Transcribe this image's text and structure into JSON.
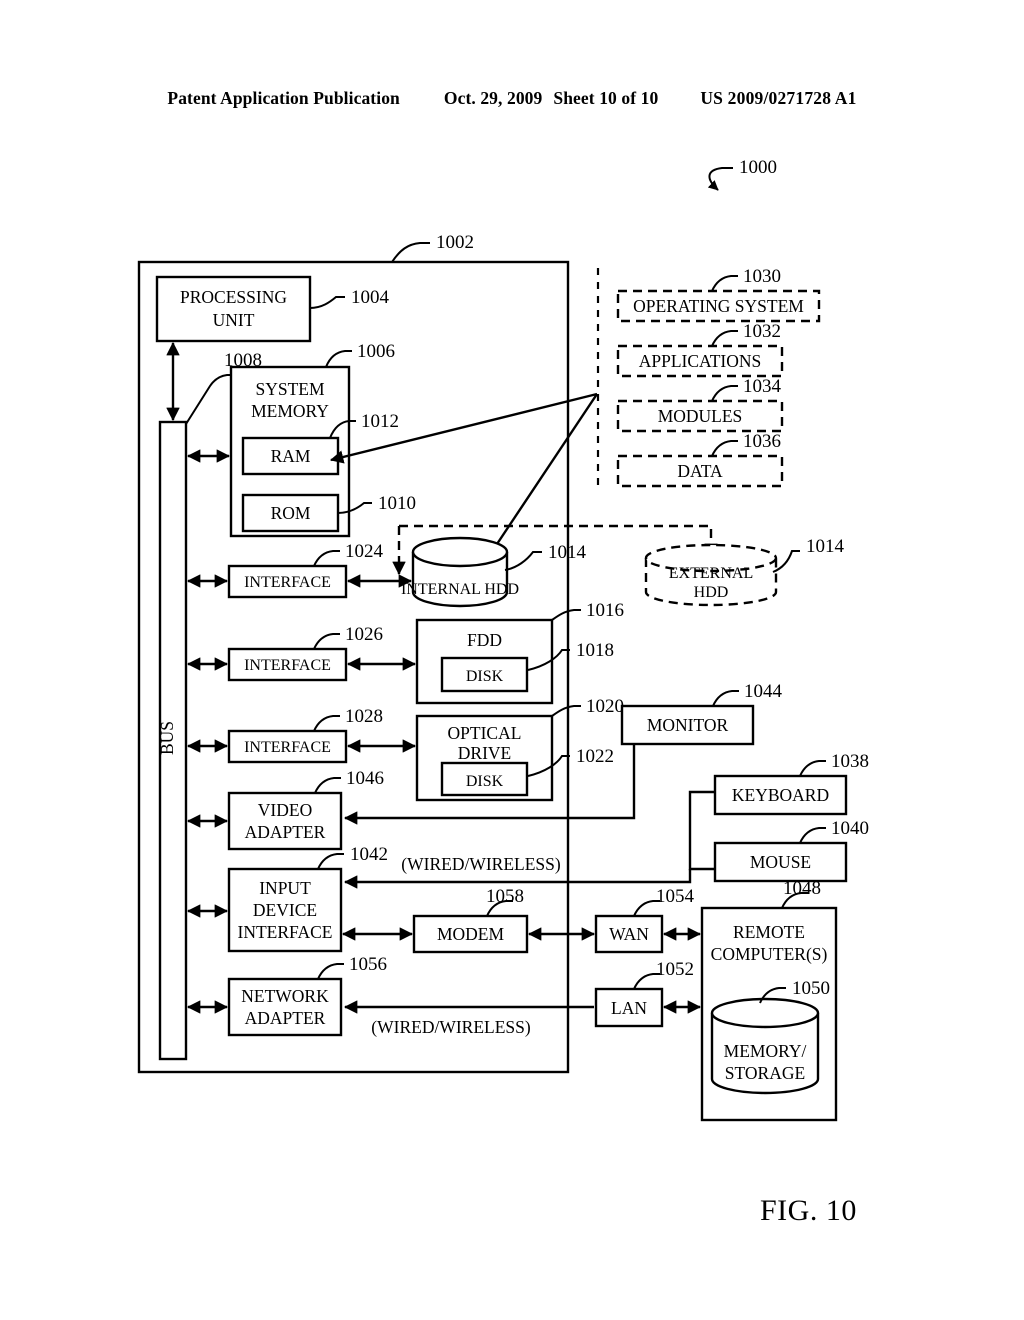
{
  "header": {
    "publication": "Patent Application Publication",
    "date": "Oct. 29, 2009",
    "sheet": "Sheet 10 of 10",
    "patent_number": "US 2009/0271728 A1"
  },
  "figure": {
    "caption": "FIG. 10",
    "system_ref": "1000"
  },
  "blocks": {
    "computer": {
      "label": "",
      "ref": "1002"
    },
    "processing_unit": {
      "label_line1": "PROCESSING",
      "label_line2": "UNIT",
      "ref": "1004"
    },
    "system_memory": {
      "label_line1": "SYSTEM",
      "label_line2": "MEMORY",
      "ref": "1006"
    },
    "bus": {
      "label": "BUS",
      "ref": "1008"
    },
    "rom": {
      "label": "ROM",
      "ref": "1010"
    },
    "ram": {
      "label": "RAM",
      "ref": "1012"
    },
    "internal_hdd": {
      "label": "INTERNAL HDD",
      "ref": "1014"
    },
    "external_hdd": {
      "label_line1": "EXTERNAL",
      "label_line2": "HDD",
      "ref": "1014"
    },
    "fdd": {
      "label": "FDD",
      "ref": "1016"
    },
    "fdd_disk": {
      "label": "DISK",
      "ref": "1018"
    },
    "optical_drive": {
      "label_line1": "OPTICAL",
      "label_line2": "DRIVE",
      "ref": "1020"
    },
    "optical_disk": {
      "label": "DISK",
      "ref": "1022"
    },
    "interface_hdd": {
      "label": "INTERFACE",
      "ref": "1024"
    },
    "interface_fdd": {
      "label": "INTERFACE",
      "ref": "1026"
    },
    "interface_optical": {
      "label": "INTERFACE",
      "ref": "1028"
    },
    "operating_system": {
      "label": "OPERATING SYSTEM",
      "ref": "1030"
    },
    "applications": {
      "label": "APPLICATIONS",
      "ref": "1032"
    },
    "modules": {
      "label": "MODULES",
      "ref": "1034"
    },
    "data": {
      "label": "DATA",
      "ref": "1036"
    },
    "keyboard": {
      "label": "KEYBOARD",
      "ref": "1038"
    },
    "mouse": {
      "label": "MOUSE",
      "ref": "1040"
    },
    "input_device_interface": {
      "label_line1": "INPUT",
      "label_line2": "DEVICE",
      "label_line3": "INTERFACE",
      "ref": "1042"
    },
    "monitor": {
      "label": "MONITOR",
      "ref": "1044"
    },
    "video_adapter": {
      "label_line1": "VIDEO",
      "label_line2": "ADAPTER",
      "ref": "1046"
    },
    "remote_computers": {
      "label_line1": "REMOTE",
      "label_line2": "COMPUTER(S)",
      "ref": "1048"
    },
    "memory_storage": {
      "label_line1": "MEMORY/",
      "label_line2": "STORAGE",
      "ref": "1050"
    },
    "lan": {
      "label": "LAN",
      "ref": "1052"
    },
    "wan": {
      "label": "WAN",
      "ref": "1054"
    },
    "network_adapter": {
      "label_line1": "NETWORK",
      "label_line2": "ADAPTER",
      "ref": "1056"
    },
    "modem": {
      "label": "MODEM",
      "ref": "1058"
    }
  },
  "annotations": {
    "wired_wireless_input": "(WIRED/WIRELESS)",
    "wired_wireless_network": "(WIRED/WIRELESS)"
  },
  "colors": {
    "ink": "#000000",
    "paper": "#ffffff"
  }
}
